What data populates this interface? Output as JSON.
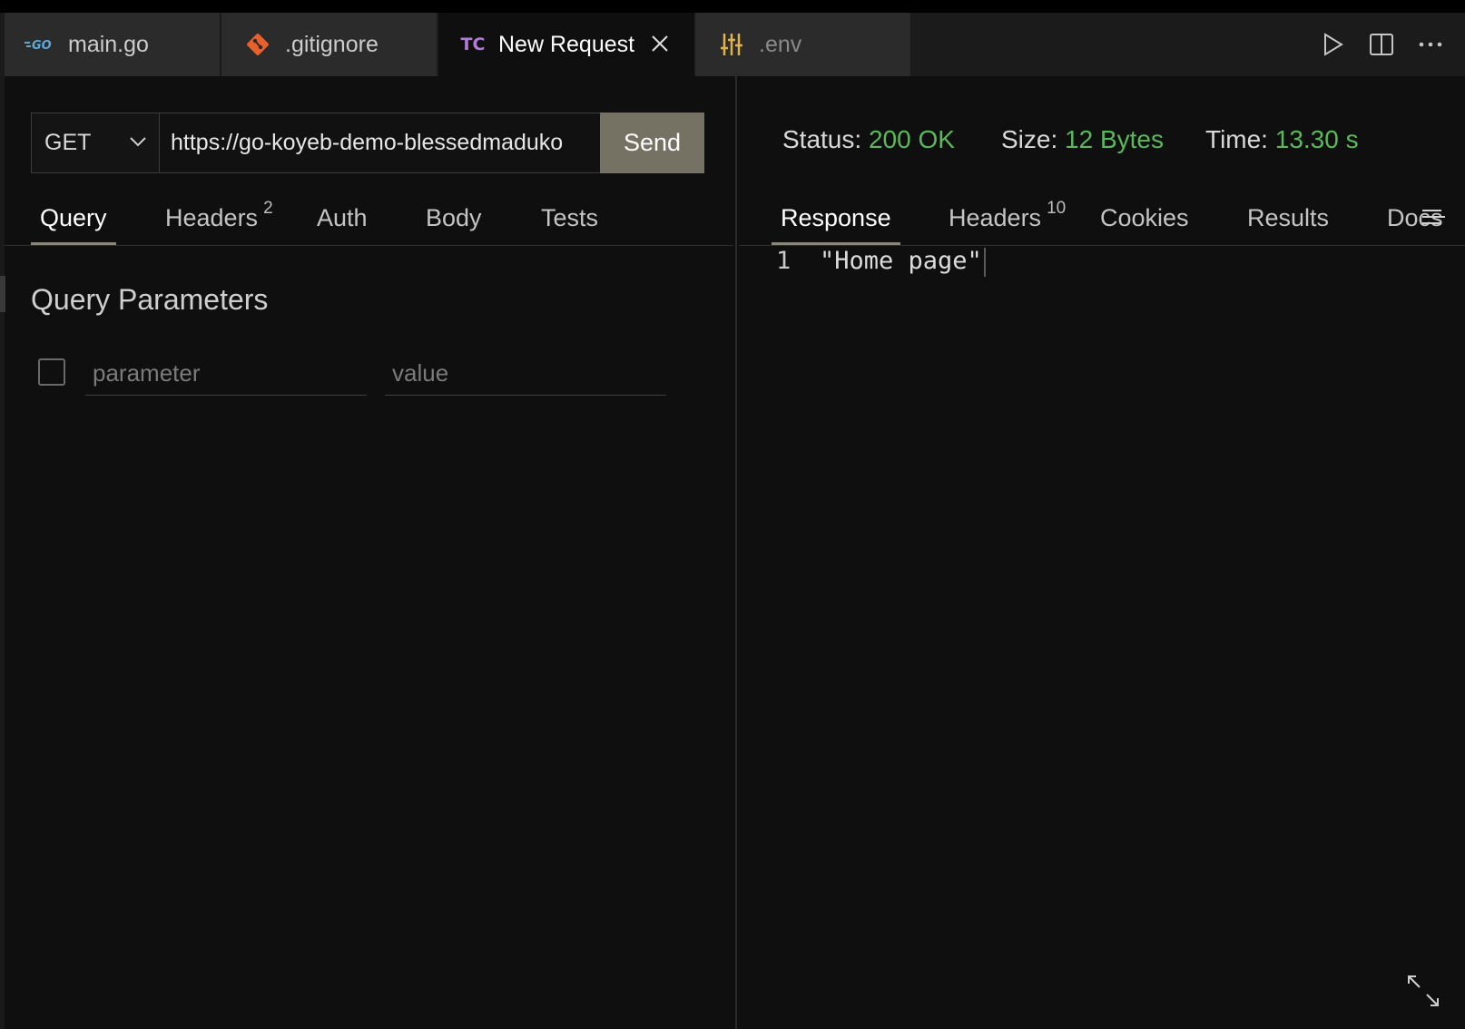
{
  "tabs": [
    {
      "label": "main.go",
      "icon": "go-icon",
      "state": "inactive"
    },
    {
      "label": ".gitignore",
      "icon": "git-icon",
      "state": "inactive"
    },
    {
      "label": "New Request",
      "icon": "thunder-client-icon",
      "icon_text": "TC",
      "state": "active"
    },
    {
      "label": ".env",
      "icon": "env-settings-icon",
      "state": "inactive"
    }
  ],
  "go_icon_text": "GO",
  "editor_actions": [
    "run-icon",
    "split-editor-icon",
    "more-actions-icon"
  ],
  "request": {
    "method": "GET",
    "url": "https://go-koyeb-demo-blessedmaduko",
    "send_label": "Send"
  },
  "request_tabs": [
    {
      "label": "Query",
      "active": true
    },
    {
      "label": "Headers",
      "badge": "2"
    },
    {
      "label": "Auth"
    },
    {
      "label": "Body"
    },
    {
      "label": "Tests"
    }
  ],
  "query": {
    "title": "Query Parameters",
    "param_placeholder": "parameter",
    "value_placeholder": "value"
  },
  "response_status": {
    "status_label": "Status:",
    "status_value": "200 OK",
    "size_label": "Size:",
    "size_value": "12 Bytes",
    "time_label": "Time:",
    "time_value": "13.30 s"
  },
  "response_tabs": [
    {
      "label": "Response",
      "active": true
    },
    {
      "label": "Headers",
      "badge": "10"
    },
    {
      "label": "Cookies"
    },
    {
      "label": "Results"
    },
    {
      "label": "Docs"
    }
  ],
  "response_body": {
    "line_number": "1",
    "content": "\"Home page\""
  },
  "colors": {
    "success": "#5cb85c",
    "send_button": "#757263",
    "git_orange": "#e8602c",
    "tc_purple": "#b07cd8",
    "env_yellow": "#e0b34a",
    "go_blue": "#5aa9d6"
  }
}
